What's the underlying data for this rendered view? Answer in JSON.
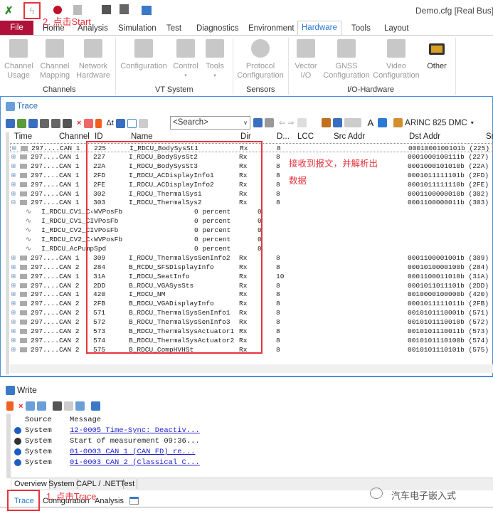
{
  "titlebar": {
    "title": "Demo.cfg [Real Bus] -",
    "annotation_start": "2. 点击Start"
  },
  "ribbon": {
    "tabs": [
      "File",
      "Home",
      "Analysis",
      "Simulation",
      "Test",
      "Diagnostics",
      "Environment",
      "Hardware",
      "Tools",
      "Layout"
    ],
    "active_tab": "Hardware",
    "groups": [
      {
        "label": "Channels",
        "buttons": [
          [
            "Channel",
            "Usage"
          ],
          [
            "Channel",
            "Mapping"
          ],
          [
            "Network",
            "Hardware"
          ]
        ]
      },
      {
        "label": "VT System",
        "buttons": [
          [
            "Configuration",
            ""
          ],
          [
            "Control",
            "▾"
          ],
          [
            "Tools",
            "▾"
          ]
        ]
      },
      {
        "label": "Sensors",
        "buttons": [
          [
            "Protocol",
            "Configuration"
          ]
        ]
      },
      {
        "label": "I/O-Hardware",
        "buttons": [
          [
            "Vector",
            "I/O"
          ],
          [
            "GNSS",
            "Configuration"
          ],
          [
            "Video",
            "Configuration"
          ],
          [
            "Other",
            ""
          ]
        ]
      }
    ]
  },
  "trace": {
    "title": "Trace",
    "search_placeholder": "<Search>",
    "protocol": "ARINC 825 DMC",
    "columns": [
      "Time",
      "Channel",
      "ID",
      "Name",
      "Dir",
      "D...",
      "LCC",
      "Src Addr",
      "Dst Addr",
      "Sr"
    ],
    "rows": [
      {
        "t": "297....",
        "ch": "CAN 1",
        "id": "225",
        "name": "I_RDCU_BodySysSt1",
        "dir": "Rx",
        "dlc": "8",
        "dst": "0001000100101b (225)"
      },
      {
        "t": "297....",
        "ch": "CAN 1",
        "id": "227",
        "name": "I_RDCU_BodySysSt2",
        "dir": "Rx",
        "dlc": "8",
        "dst": "0001000100111b (227)"
      },
      {
        "t": "297....",
        "ch": "CAN 1",
        "id": "22A",
        "name": "I_RDCU_BodySysSt3",
        "dir": "Rx",
        "dlc": "8",
        "dst": "0001000101010b (22A)"
      },
      {
        "t": "297....",
        "ch": "CAN 1",
        "id": "2FD",
        "name": "I_RDCU_ACDisplayInfo1",
        "dir": "Rx",
        "dlc": "8",
        "dst": "0001011111101b (2FD)"
      },
      {
        "t": "297....",
        "ch": "CAN 1",
        "id": "2FE",
        "name": "I_RDCU_ACDisplayInfo2",
        "dir": "Rx",
        "dlc": "8",
        "dst": "0001011111110b (2FE)"
      },
      {
        "t": "297....",
        "ch": "CAN 1",
        "id": "302",
        "name": "I_RDCU_ThermalSys1",
        "dir": "Rx",
        "dlc": "8",
        "dst": "0001100000010b (302)"
      },
      {
        "t": "297....",
        "ch": "CAN 1",
        "id": "303",
        "name": "I_RDCU_ThermalSys2",
        "dir": "Rx",
        "dlc": "8",
        "dst": "0001100000011b (303)",
        "expanded": true
      }
    ],
    "signals": [
      {
        "name": "I_RDCU_CV1_C‹WVPosFb",
        "value": "0 percent",
        "raw": "0"
      },
      {
        "name": "I_RDCU_CV1_CIVPosFb",
        "value": "0 percent",
        "raw": "0"
      },
      {
        "name": "I_RDCU_CV2_CIVPosFb",
        "value": "0 percent",
        "raw": "0"
      },
      {
        "name": "I_RDCU_CV2_C‹WVPosFb",
        "value": "0 percent",
        "raw": "0"
      },
      {
        "name": "I_RDCU_AcPumpSpd",
        "value": "0 percent",
        "raw": "0"
      }
    ],
    "rows2": [
      {
        "t": "297....",
        "ch": "CAN 1",
        "id": "309",
        "name": "I_RDCU_ThermalSysSenInfo2",
        "dir": "Rx",
        "dlc": "8",
        "dst": "0001100001001b (309)"
      },
      {
        "t": "297....",
        "ch": "CAN 2",
        "id": "284",
        "name": "B_RCDU_SFSDisplayInfo",
        "dir": "Rx",
        "dlc": "8",
        "dst": "0001010000100b (284)"
      },
      {
        "t": "297....",
        "ch": "CAN 1",
        "id": "31A",
        "name": "I_RDCU_SeatInfo",
        "dir": "Rx",
        "dlc": "10",
        "dst": "0001100011010b (31A)"
      },
      {
        "t": "297....",
        "ch": "CAN 2",
        "id": "2DD",
        "name": "B_RDCU_VGASysSts",
        "dir": "Rx",
        "dlc": "8",
        "dst": "0001011011101b (2DD)"
      },
      {
        "t": "297....",
        "ch": "CAN 1",
        "id": "420",
        "name": "I_RDCU_NM",
        "dir": "Rx",
        "dlc": "8",
        "dst": "0010000100000b (420)"
      },
      {
        "t": "297....",
        "ch": "CAN 2",
        "id": "2FB",
        "name": "B_RDCU_VGADisplayInfo",
        "dir": "Rx",
        "dlc": "8",
        "dst": "0001011111011b (2FB)"
      },
      {
        "t": "297....",
        "ch": "CAN 2",
        "id": "571",
        "name": "B_RDCU_ThermalSysSenInfo1",
        "dir": "Rx",
        "dlc": "8",
        "dst": "0010101110001b (571)"
      },
      {
        "t": "297....",
        "ch": "CAN 2",
        "id": "572",
        "name": "B_RDCU_ThermalSysSenInfo3",
        "dir": "Rx",
        "dlc": "8",
        "dst": "0010101110010b (572)"
      },
      {
        "t": "297....",
        "ch": "CAN 2",
        "id": "573",
        "name": "B_RDCU_ThermalSysActuator1",
        "dir": "Rx",
        "dlc": "8",
        "dst": "0010101110011b (573)"
      },
      {
        "t": "297....",
        "ch": "CAN 2",
        "id": "574",
        "name": "B_RDCU_ThermalSysActuator2",
        "dir": "Rx",
        "dlc": "8",
        "dst": "0010101110100b (574)"
      },
      {
        "t": "297....",
        "ch": "CAN 2",
        "id": "575",
        "name": "B_RDCU_CompHVHSt",
        "dir": "Rx",
        "dlc": "8",
        "dst": "0010101110101b (575)"
      }
    ],
    "annotation_line1": "接收到报文，并解析出",
    "annotation_line2": "数据"
  },
  "write": {
    "title": "Write",
    "columns": [
      "Source",
      "Message"
    ],
    "rows": [
      {
        "icon": "info-icon",
        "source": "System",
        "message": "12-0005 Time-Sync: Deactiv...",
        "link": true
      },
      {
        "icon": "bullet-icon",
        "source": "System",
        "message": "Start of measurement 09:36...",
        "link": false
      },
      {
        "icon": "info-icon",
        "source": "System",
        "message": "01-0003 CAN 1 (CAN FD)  re...",
        "link": true
      },
      {
        "icon": "info-icon",
        "source": "System",
        "message": "01-0003 CAN 2 (Classical C...",
        "link": true
      }
    ],
    "tabs": [
      "Overview",
      "System",
      "CAPL / .NET",
      "Test"
    ]
  },
  "bottom_tabs": [
    "Trace",
    "Configuration",
    "Analysis"
  ],
  "annotation_trace": "1. 点击Trace",
  "watermark": "汽车电子嵌入式",
  "colors": {
    "file_tab": "#b0113a",
    "accent": "#2a7ad5",
    "annotation": "#e8323c",
    "link": "#2222cc"
  }
}
